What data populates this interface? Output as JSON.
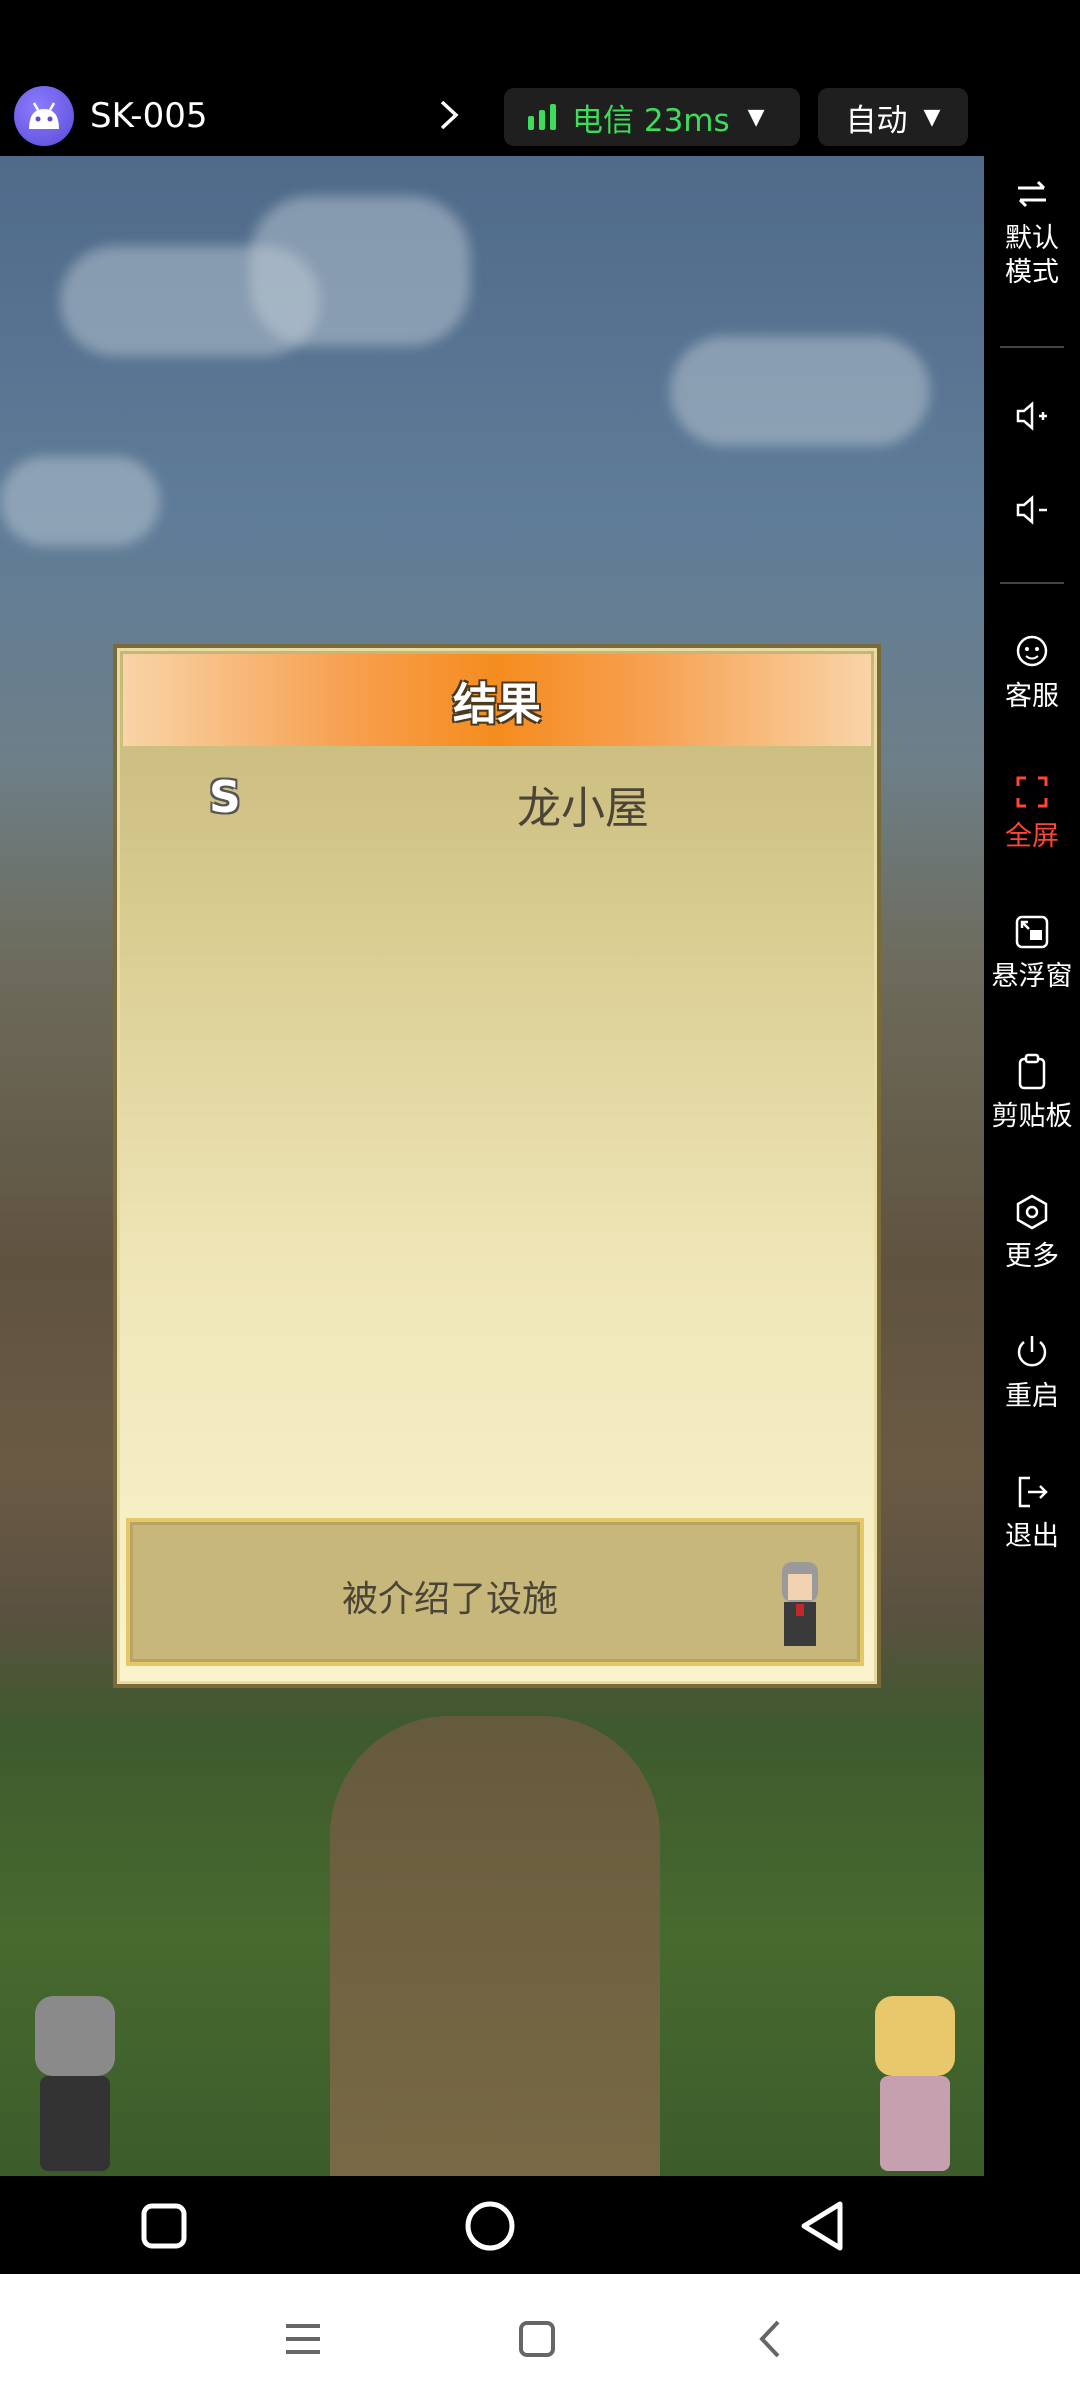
{
  "topbar": {
    "device_name": "SK-005",
    "network": "电信 23ms",
    "mode": "自动",
    "icons": [
      "android-avatar-icon",
      "chevron-right-icon",
      "signal-bars-icon",
      "caret-down-icon"
    ]
  },
  "dialog": {
    "title": "结果",
    "rank": "S",
    "facility": "龙小屋",
    "message": "被介绍了设施"
  },
  "side_panel": {
    "items": [
      {
        "label": "默认\n模式",
        "icon": "swap-icon"
      },
      {
        "label": "",
        "icon": "volume-up-icon"
      },
      {
        "label": "",
        "icon": "volume-down-icon"
      },
      {
        "label": "客服",
        "icon": "support-icon"
      },
      {
        "label": "全屏",
        "icon": "fullscreen-icon"
      },
      {
        "label": "悬浮窗",
        "icon": "float-window-icon"
      },
      {
        "label": "剪贴板",
        "icon": "clipboard-icon"
      },
      {
        "label": "更多",
        "icon": "more-icon"
      },
      {
        "label": "重启",
        "icon": "power-icon"
      },
      {
        "label": "退出",
        "icon": "exit-icon"
      }
    ],
    "active_color": "#ff4438"
  },
  "colors": {
    "signal_green": "#3ddc5a",
    "dialog_header": "#f58c1e"
  }
}
